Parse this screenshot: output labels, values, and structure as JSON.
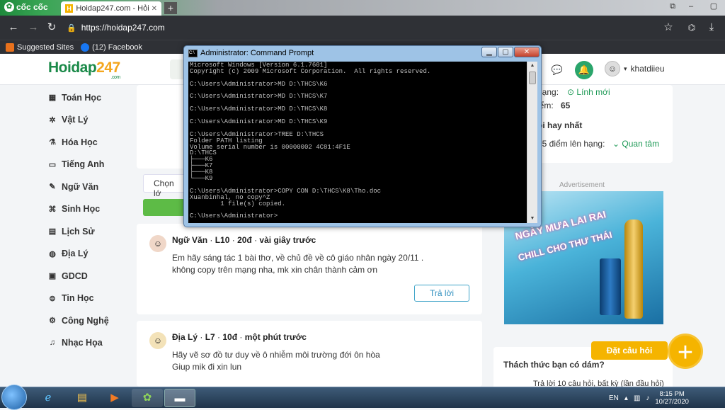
{
  "browser": {
    "brand": "cốc cốc",
    "active_tab_title": "Hoidap247.com - Hỏi đáp",
    "url": "https://hoidap247.com",
    "bookmarks": [
      "Suggested Sites",
      "(12) Facebook"
    ]
  },
  "site": {
    "logo": "Hoidap247",
    "logo_sub": ".com",
    "username": "khatdiieu"
  },
  "sidebar": {
    "items": [
      {
        "label": "Toán Học",
        "icon": "calculator-icon",
        "glyph": "▦"
      },
      {
        "label": "Vật Lý",
        "icon": "atom-icon",
        "glyph": "✲"
      },
      {
        "label": "Hóa Học",
        "icon": "flask-icon",
        "glyph": "⚗"
      },
      {
        "label": "Tiếng Anh",
        "icon": "language-icon",
        "glyph": "▭"
      },
      {
        "label": "Ngữ Văn",
        "icon": "pen-icon",
        "glyph": "✎"
      },
      {
        "label": "Sinh Học",
        "icon": "dna-icon",
        "glyph": "⌘"
      },
      {
        "label": "Lịch Sử",
        "icon": "scroll-icon",
        "glyph": "▤"
      },
      {
        "label": "Địa Lý",
        "icon": "globe-icon",
        "glyph": "◍"
      },
      {
        "label": "GDCD",
        "icon": "civics-icon",
        "glyph": "▣"
      },
      {
        "label": "Tin Học",
        "icon": "computer-icon",
        "glyph": "⊜"
      },
      {
        "label": "Công Nghệ",
        "icon": "tech-icon",
        "glyph": "⚙"
      },
      {
        "label": "Nhạc Họa",
        "icon": "music-icon",
        "glyph": "♫"
      }
    ]
  },
  "main": {
    "filter_label": "Chọn lớ",
    "questions": [
      {
        "subject": "Ngữ Văn",
        "grade": "L10",
        "points": "20đ",
        "time": "vài giây trước",
        "text_1": "Em hãy sáng tác 1 bài thơ, về chủ đề về cô giáo nhân ngày 20/11 .",
        "text_2": "không copy trên mạng nha, mk xin chân thành cảm ơn",
        "answer_label": "Trả lời"
      },
      {
        "subject": "Địa Lý",
        "grade": "L7",
        "points": "10đ",
        "time": "một phút trước",
        "text_1": "Hãy vẽ sơ đồ tư duy về ô nhiễm môi trường đới ôn hòa",
        "text_2": "Giup mik đi xin lun"
      }
    ]
  },
  "right": {
    "rank_label": "hạng:",
    "rank_value": "Lính mới",
    "points_label": "iểm:",
    "points_value": "65",
    "best_label": "ỏi hay nhất",
    "next_label": "25 điểm lên hạng:",
    "follow_label": "Quan tâm",
    "ad_label": "Advertisement",
    "ad_line_1": "NGÀY MƯA LAI RAI",
    "ad_line_2": "CHILL CHO THƯ THÁI",
    "challenge_title": "Thách thức bạn có dám?",
    "challenge_text": "Trả lời 10 câu hỏi, bất kỳ (lần đầu hỏi)",
    "post_question": "Đặt câu hỏi"
  },
  "cmd": {
    "title": "Administrator: Command Prompt",
    "lines": [
      "Microsoft Windows [Version 6.1.7601]",
      "Copyright (c) 2009 Microsoft Corporation.  All rights reserved.",
      "",
      "C:\\Users\\Administrator>MD D:\\THCS\\K6",
      "",
      "C:\\Users\\Administrator>MD D:\\THCS\\K7",
      "",
      "C:\\Users\\Administrator>MD D:\\THCS\\K8",
      "",
      "C:\\Users\\Administrator>MD D:\\THCS\\K9",
      "",
      "C:\\Users\\Administrator>TREE D:\\THCS",
      "Folder PATH listing",
      "Volume serial number is 00000002 4C81:4F1E",
      "D:\\THCS",
      "├───K6",
      "├───K7",
      "├───K8",
      "└───K9",
      "",
      "C:\\Users\\Administrator>COPY CON D:\\THCS\\K8\\Tho.doc",
      "Xuanbinhal, no copy^Z",
      "        1 file(s) copied.",
      "",
      "C:\\Users\\Administrator>"
    ]
  },
  "taskbar": {
    "lang": "EN",
    "time": "8:15 PM",
    "date": "10/27/2020"
  }
}
